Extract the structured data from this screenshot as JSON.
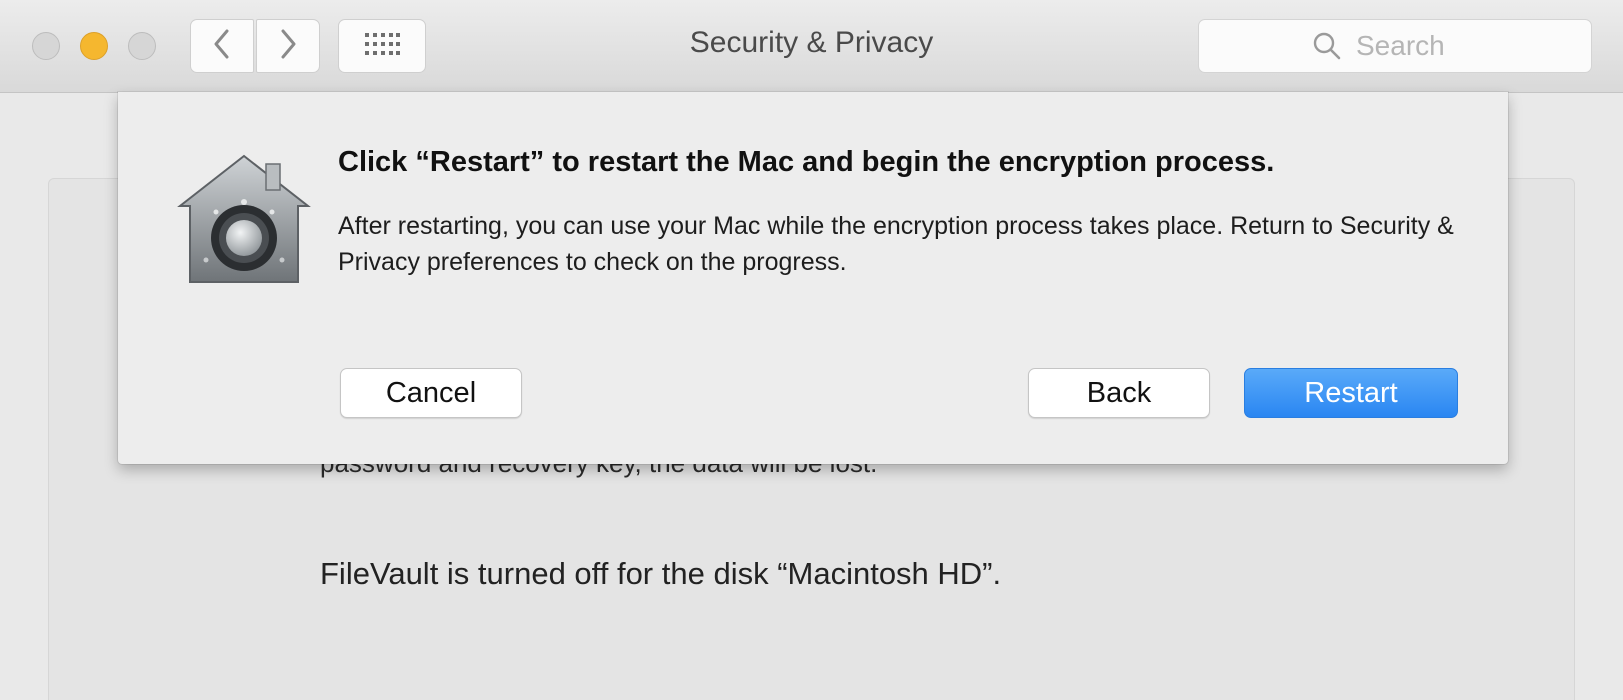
{
  "window": {
    "title": "Security & Privacy"
  },
  "toolbar": {
    "back_icon": "chevron-left-icon",
    "forward_icon": "chevron-right-icon",
    "grid_icon": "show-all-grid-icon"
  },
  "search": {
    "placeholder": "Search",
    "value": "",
    "icon": "search-icon"
  },
  "pane": {
    "cut_off_text": "password and recovery key, the data will be lost.",
    "status_text": "FileVault is turned off for the disk “Macintosh HD”."
  },
  "sheet": {
    "icon": "filevault-lock-icon",
    "heading": "Click “Restart” to restart the Mac and begin the encryption process.",
    "body": "After restarting, you can use your Mac while the encryption process takes place. Return to Security & Privacy preferences to check on the progress.",
    "buttons": {
      "cancel": "Cancel",
      "back": "Back",
      "restart": "Restart"
    }
  },
  "colors": {
    "accent": "#2a86f2",
    "minimize": "#f5b72f"
  }
}
